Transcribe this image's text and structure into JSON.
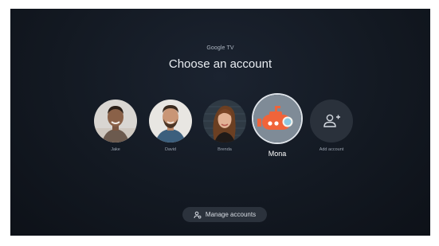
{
  "header": {
    "brand": "Google TV",
    "title": "Choose an account"
  },
  "accounts": [
    {
      "name": "Jake",
      "avatar": "photo-jake",
      "selected": false
    },
    {
      "name": "David",
      "avatar": "photo-david",
      "selected": false
    },
    {
      "name": "Brenda",
      "avatar": "photo-brenda",
      "selected": false
    },
    {
      "name": "Mona",
      "avatar": "submarine-avatar",
      "selected": true
    },
    {
      "name": "Add account",
      "avatar": "add-person-icon",
      "selected": false
    }
  ],
  "footer": {
    "manage_label": "Manage accounts",
    "manage_icon": "manage-accounts-icon"
  },
  "colors": {
    "background": "#131922",
    "submarine": "#f0643a",
    "selected_ring": "#dfe4ea"
  }
}
